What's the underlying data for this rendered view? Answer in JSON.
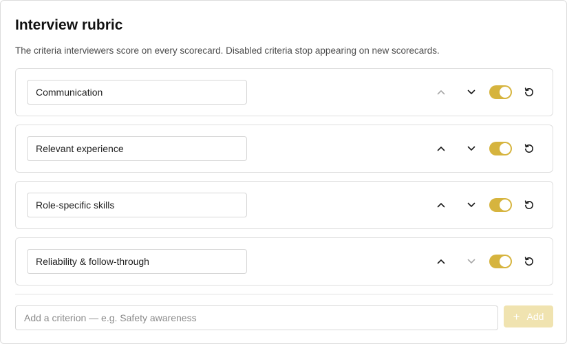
{
  "header": {
    "title": "Interview rubric",
    "subtitle": "The criteria interviewers score on every scorecard. Disabled criteria stop appearing on new scorecards."
  },
  "criteria": [
    {
      "label": "Communication",
      "enabled": true,
      "move_up_disabled": true,
      "move_down_disabled": false
    },
    {
      "label": "Relevant experience",
      "enabled": true,
      "move_up_disabled": false,
      "move_down_disabled": false
    },
    {
      "label": "Role-specific skills",
      "enabled": true,
      "move_up_disabled": false,
      "move_down_disabled": false
    },
    {
      "label": "Reliability & follow-through",
      "enabled": true,
      "move_up_disabled": false,
      "move_down_disabled": true
    }
  ],
  "icons": {
    "move_up": "chevron-up-icon",
    "move_down": "chevron-down-icon",
    "reset": "reset-icon",
    "add": "plus-icon"
  },
  "add_form": {
    "placeholder": "Add a criterion — e.g. Safety awareness",
    "value": "",
    "button_label": "Add",
    "button_icon": "+"
  },
  "colors": {
    "toggle_on": "#d6b43e",
    "add_button_disabled": "#f0e3b0",
    "icon_active": "#1a1a1a",
    "icon_disabled": "#a8a8a8"
  }
}
